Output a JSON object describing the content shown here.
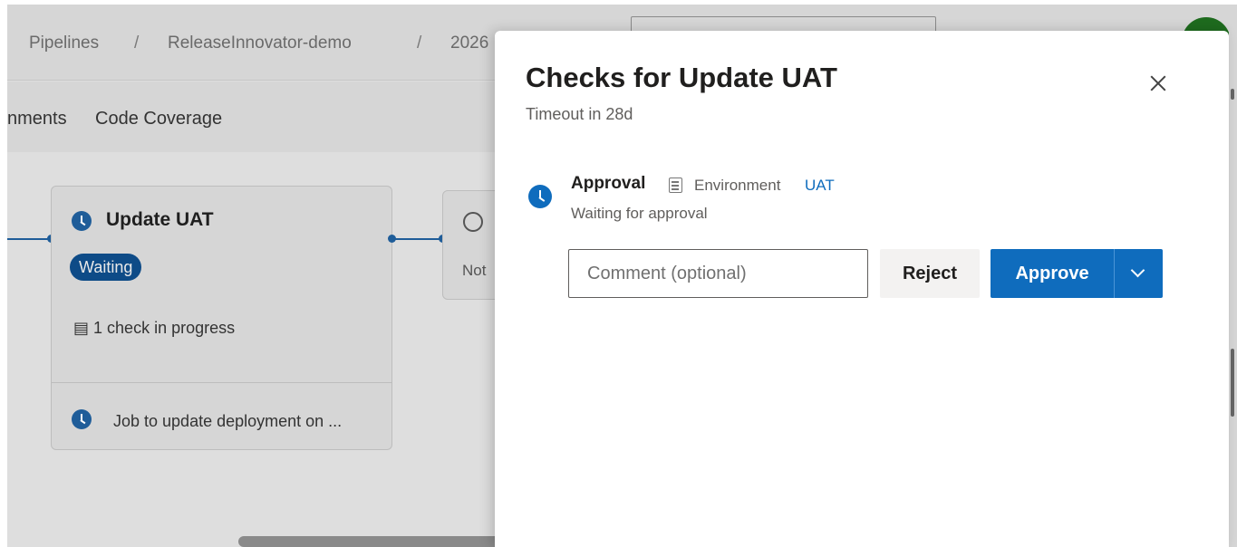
{
  "breadcrumb": {
    "items": [
      "Pipelines",
      "ReleaseInnovator-demo",
      "2026"
    ],
    "separator": "/"
  },
  "tabs": [
    "nments",
    "Code Coverage"
  ],
  "stage": {
    "title": "Update UAT",
    "status": "Waiting",
    "checks": "1 check in progress",
    "job": "Job to update deployment on ..."
  },
  "next_stage": {
    "status": "Not"
  },
  "panel": {
    "title": "Checks for Update UAT",
    "subtitle": "Timeout in 28d",
    "approval": {
      "title": "Approval",
      "env_label": "Environment",
      "env_link": "UAT",
      "status": "Waiting for approval"
    },
    "comment_placeholder": "Comment (optional)",
    "reject_label": "Reject",
    "approve_label": "Approve"
  },
  "icons": {
    "stage_status": "clock-icon",
    "approval_status": "clock-icon",
    "environment": "environment-icon",
    "close": "close-icon",
    "split": "chevron-down-icon"
  },
  "colors": {
    "accent": "#0f6cbd",
    "waiting_pill": "#0e4b87",
    "avatar": "#1e6b1e"
  }
}
